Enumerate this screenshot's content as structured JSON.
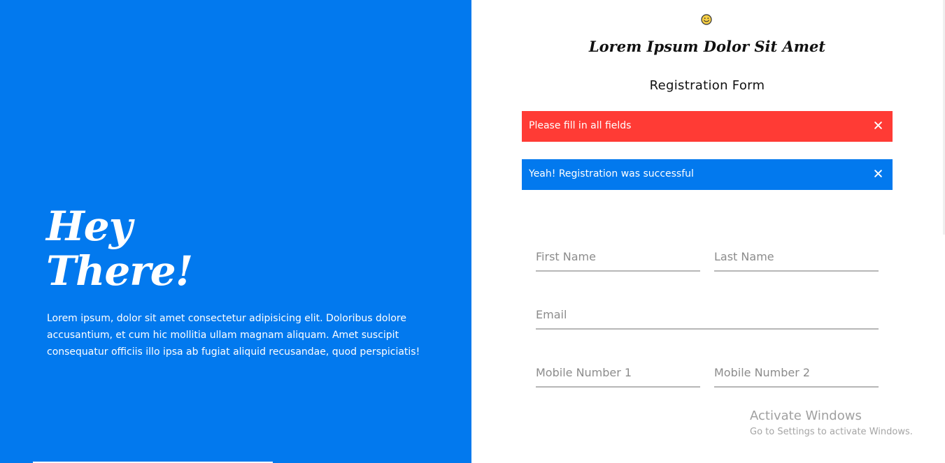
{
  "colors": {
    "primary_blue": "#0279ee",
    "error_red": "#ff3b35",
    "white": "#ffffff",
    "text_dark": "#111111",
    "muted_text": "#8c8c8c",
    "underline": "#b7b7b7"
  },
  "icons": {
    "brand_icon": "smiley-icon",
    "close_icon": "close-icon"
  },
  "hero": {
    "line1": "Hey",
    "line2": "There!",
    "body": "Lorem ipsum, dolor sit amet consectetur adipisicing elit. Doloribus dolore accusantium, et cum hic mollitia ullam magnam aliquam. Amet suscipit consequatur officiis illo ipsa ab fugiat aliquid recusandae, quod perspiciatis!"
  },
  "brand": {
    "title": "Lorem Ipsum Dolor Sit Amet"
  },
  "form": {
    "title": "Registration Form",
    "fields": {
      "first_name": {
        "placeholder": "First Name",
        "value": ""
      },
      "last_name": {
        "placeholder": "Last Name",
        "value": ""
      },
      "email": {
        "placeholder": "Email",
        "value": ""
      },
      "mobile1": {
        "placeholder": "Mobile Number 1",
        "value": ""
      },
      "mobile2": {
        "placeholder": "Mobile Number 2",
        "value": ""
      }
    }
  },
  "alerts": {
    "error": {
      "message": "Please fill in all fields"
    },
    "success": {
      "message": "Yeah! Registration was successful"
    }
  },
  "overlay": {
    "activation_title": "Activate Windows",
    "activation_subtitle": "Go to Settings to activate Windows."
  }
}
